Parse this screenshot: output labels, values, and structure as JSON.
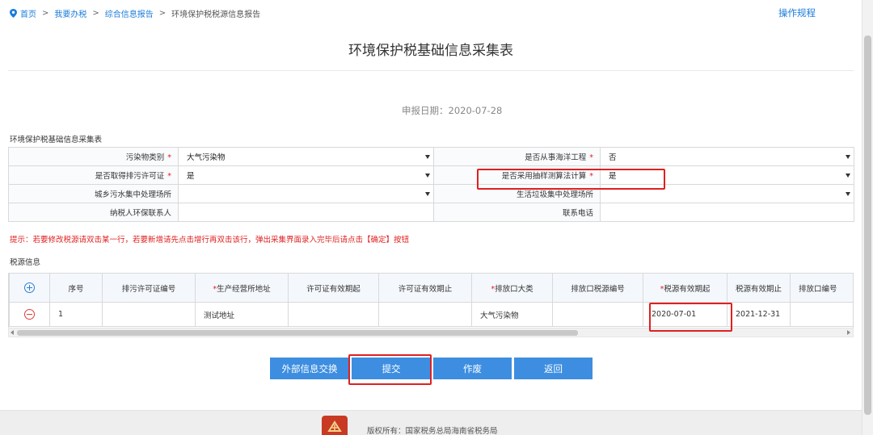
{
  "breadcrumb": {
    "items": [
      "首页",
      "我要办税",
      "综合信息报告"
    ],
    "current": "环境保护税税源信息报告",
    "separator": ">"
  },
  "header": {
    "op_guide": "操作规程"
  },
  "title": "环境保护税基础信息采集表",
  "report_date": {
    "label": "申报日期：",
    "value": "2020-07-28"
  },
  "form": {
    "section_label": "环境保护税基础信息采集表",
    "pollutant_type": {
      "label": "污染物类别",
      "value": "大气污染物"
    },
    "marine_project": {
      "label": "是否从事海洋工程",
      "value": "否"
    },
    "permit": {
      "label": "是否取得排污许可证",
      "value": "是"
    },
    "sampling_method": {
      "label": "是否采用抽样测算法计算",
      "value": "是"
    },
    "sewage_site": {
      "label": "城乡污水集中处理场所",
      "value": ""
    },
    "garbage_site": {
      "label": "生活垃圾集中处理场所",
      "value": ""
    },
    "contact_person": {
      "label": "纳税人环保联系人",
      "value": ""
    },
    "phone": {
      "label": "联系电话",
      "value": ""
    },
    "required_mark": "*"
  },
  "hint": "提示：若要修改税源请双击某一行，若要新增请先点击增行再双击该行，弹出采集界面录入完毕后请点击【确定】按钮",
  "tax_source": {
    "section_label": "税源信息",
    "columns": [
      "序号",
      "排污许可证编号",
      "*生产经营所地址",
      "许可证有效期起",
      "许可证有效期止",
      "*排放口大类",
      "排放口税源编号",
      "*税源有效期起",
      "税源有效期止",
      "排放口编号"
    ],
    "rows": [
      {
        "index": "1",
        "permit_no": "",
        "address": "测试地址",
        "permit_start": "",
        "permit_end": "",
        "outlet_type": "大气污染物",
        "outlet_source_no": "",
        "valid_start": "2020-07-01",
        "valid_end": "2021-12-31",
        "outlet_no": ""
      }
    ]
  },
  "buttons": {
    "external": "外部信息交换",
    "submit": "提交",
    "void": "作废",
    "back": "返回"
  },
  "footer": {
    "copyright": "版权所有：国家税务总局海南省税务局"
  },
  "colors": {
    "primary": "#3d8ee0",
    "link": "#1b7cd9",
    "required": "#e02020",
    "highlight": "#e02020"
  }
}
